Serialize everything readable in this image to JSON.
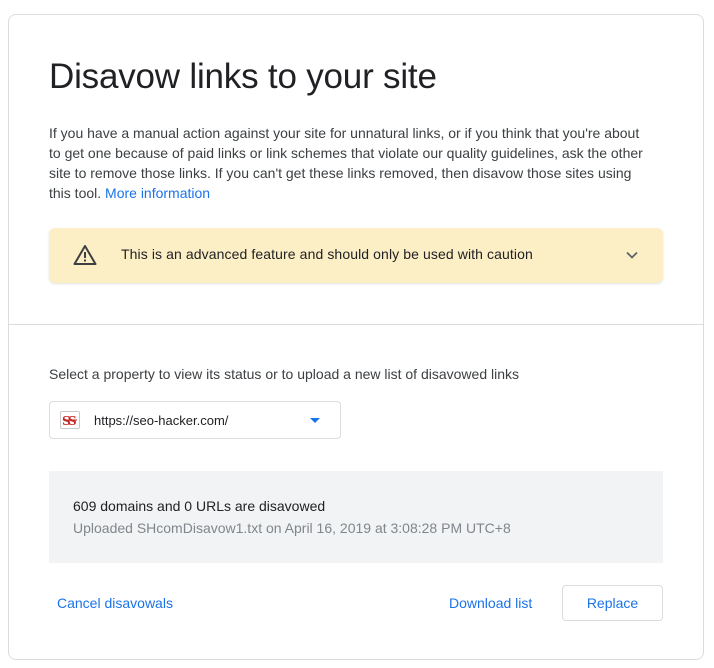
{
  "page": {
    "title": "Disavow links to your site",
    "description": "If you have a manual action against your site for unnatural links, or if you think that you're about to get one because of paid links or link schemes that violate our quality guidelines, ask the other site to remove those links. If you can't get these links removed, then disavow those sites using this tool.",
    "more_info_link": "More information"
  },
  "warning": {
    "icon": "warning-triangle-icon",
    "text": "This is an advanced feature and should only be used with caution",
    "expand_icon": "chevron-down-icon"
  },
  "property": {
    "prompt": "Select a property to view its status or to upload a new list of disavowed links",
    "selected": "https://seo-hacker.com/",
    "favicon": "site-favicon-icon"
  },
  "status": {
    "summary": "609 domains and 0 URLs are disavowed",
    "upload_info": "Uploaded SHcomDisavow1.txt on April 16, 2019 at 3:08:28 PM UTC+8"
  },
  "actions": {
    "cancel": "Cancel disavowals",
    "download": "Download list",
    "replace": "Replace"
  },
  "colors": {
    "accent": "#1a73e8",
    "warning_bg": "#fdefc5",
    "status_bg": "#f1f3f4",
    "border": "#dadce0"
  }
}
